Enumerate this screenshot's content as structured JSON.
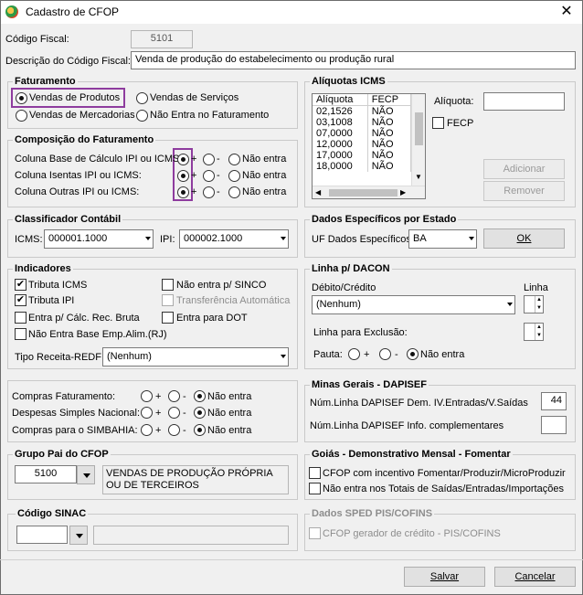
{
  "window": {
    "title": "Cadastro de CFOP"
  },
  "header": {
    "codigo_label": "Código Fiscal:",
    "codigo_value": "5101",
    "descricao_label": "Descrição do Código Fiscal:",
    "descricao_value": "Venda de produção do estabelecimento ou produção rural"
  },
  "faturamento": {
    "title": "Faturamento",
    "opt1": "Vendas de Produtos",
    "opt2": "Vendas de Serviços",
    "opt3": "Vendas de Mercadorias",
    "opt4": "Não Entra no Faturamento",
    "selected": "Vendas de Produtos"
  },
  "composicao": {
    "title": "Composição do Faturamento",
    "rows": [
      {
        "label": "Coluna Base de Cálculo IPI ou ICMS:"
      },
      {
        "label": "Coluna Isentas IPI ou ICMS:"
      },
      {
        "label": "Coluna Outras IPI ou ICMS:"
      }
    ],
    "plus": "+",
    "minus": "-",
    "nao_entra": "Não entra"
  },
  "aliquotas": {
    "title": "Alíquotas ICMS",
    "col1": "Alíquota",
    "col2": "FECP",
    "rows": [
      {
        "a": "02,1526",
        "f": "NÃO"
      },
      {
        "a": "03,1008",
        "f": "NÃO"
      },
      {
        "a": "07,0000",
        "f": "NÃO"
      },
      {
        "a": "12,0000",
        "f": "NÃO"
      },
      {
        "a": "17,0000",
        "f": "NÃO"
      },
      {
        "a": "18,0000",
        "f": "NÃO"
      }
    ],
    "aliquota_label": "Alíquota:",
    "fecp_label": "FECP",
    "adicionar": "Adicionar",
    "remover": "Remover"
  },
  "classificador": {
    "title": "Classificador Contábil",
    "icms_label": "ICMS:",
    "icms_value": "000001.1000",
    "ipi_label": "IPI:",
    "ipi_value": "000002.1000"
  },
  "dados_estado": {
    "title": "Dados Específicos por Estado",
    "uf_label": "UF Dados Específicos:",
    "uf_value": "BA",
    "ok": "OK"
  },
  "indicadores": {
    "title": "Indicadores",
    "tributa_icms": "Tributa ICMS",
    "tributa_ipi": "Tributa IPI",
    "entra_calc": "Entra p/ Cálc. Rec. Bruta",
    "nao_entra_base": "Não Entra Base Emp.Alim.(RJ)",
    "nao_entra_sinco": "Não entra p/ SINCO",
    "transferencia": "Transferência Automática",
    "entra_dot": "Entra para DOT",
    "tipo_receita_label": "Tipo Receita-REDF:",
    "tipo_receita_value": "(Nenhum)"
  },
  "dacon": {
    "title": "Linha p/ DACON",
    "debito_label": "Débito/Crédito",
    "linha_label": "Linha",
    "debito_value": "(Nenhum)",
    "exclusao_label": "Linha para Exclusão:",
    "pauta_label": "Pauta:",
    "plus": "+",
    "minus": "-",
    "nao_entra": "Não entra"
  },
  "compras": {
    "rows": [
      {
        "label": "Compras Faturamento:"
      },
      {
        "label": "Despesas Simples Nacional:"
      },
      {
        "label": "Compras para o SIMBAHIA:"
      }
    ],
    "plus": "+",
    "minus": "-",
    "nao_entra": "Não entra"
  },
  "minas": {
    "title": "Minas Gerais - DAPISEF",
    "linha1_label": "Núm.Linha DAPISEF Dem. IV.Entradas/V.Saídas",
    "linha1_value": "44",
    "linha2_label": "Núm.Linha DAPISEF Info. complementares",
    "linha2_value": ""
  },
  "grupo_pai": {
    "title": "Grupo Pai do CFOP",
    "code": "5100",
    "desc": "VENDAS DE PRODUÇÃO PRÓPRIA OU DE TERCEIROS"
  },
  "goias": {
    "title": "Goiás - Demonstrativo Mensal - Fomentar",
    "opt1": "CFOP com incentivo  Fomentar/Produzir/MicroProduzir",
    "opt2": "Não entra nos Totais de  Saídas/Entradas/Importações"
  },
  "sinac": {
    "title": "Código SINAC"
  },
  "sped": {
    "title": "Dados SPED PIS/COFINS",
    "gerador": "CFOP gerador de crédito - PIS/COFINS"
  },
  "footer": {
    "salvar": "Salvar",
    "cancelar": "Cancelar"
  }
}
